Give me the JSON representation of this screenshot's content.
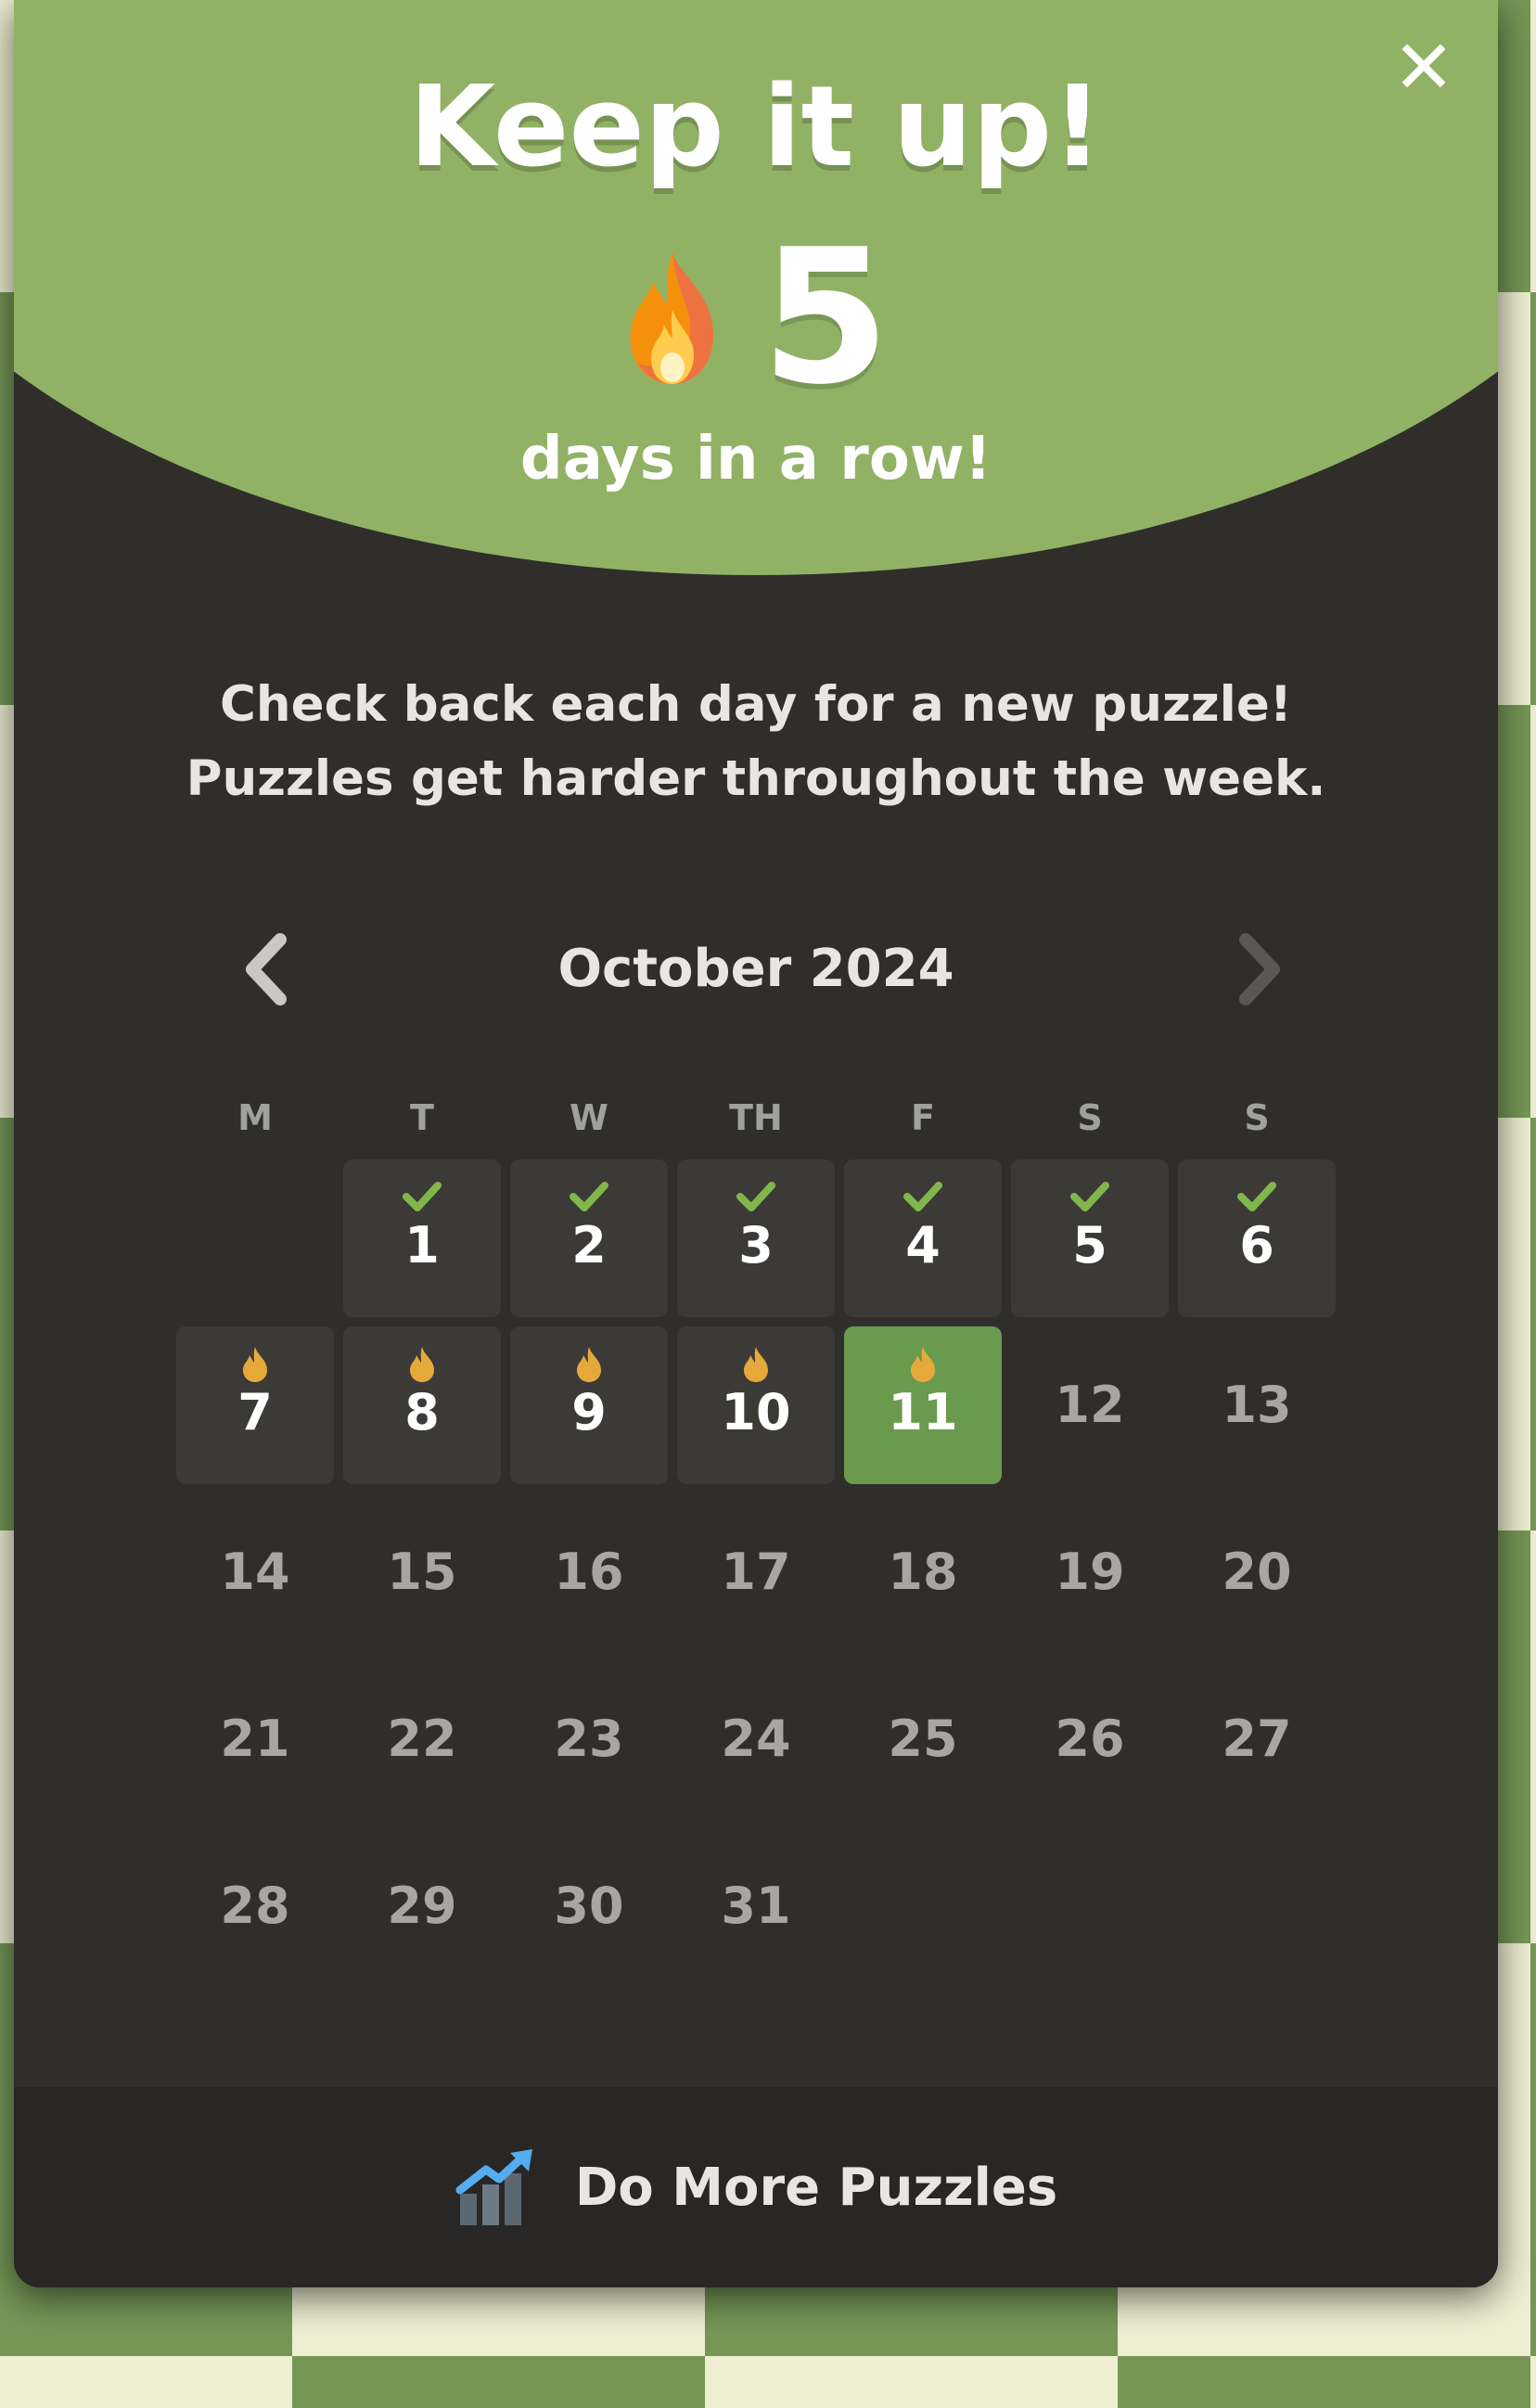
{
  "modal": {
    "title": "Keep it up!",
    "close_label": "✕",
    "streak_count": "5",
    "streak_label": "days in a row!",
    "message_line1": "Check back each day for a new puzzle!",
    "message_line2": "Puzzles get harder throughout the week."
  },
  "calendar": {
    "month_label": "October 2024",
    "weekdays": [
      "M",
      "T",
      "W",
      "TH",
      "F",
      "S",
      "S"
    ],
    "days": [
      {
        "num": "1",
        "status": "completed"
      },
      {
        "num": "2",
        "status": "completed"
      },
      {
        "num": "3",
        "status": "completed"
      },
      {
        "num": "4",
        "status": "completed"
      },
      {
        "num": "5",
        "status": "completed"
      },
      {
        "num": "6",
        "status": "completed"
      },
      {
        "num": "7",
        "status": "streak"
      },
      {
        "num": "8",
        "status": "streak"
      },
      {
        "num": "9",
        "status": "streak"
      },
      {
        "num": "10",
        "status": "streak"
      },
      {
        "num": "11",
        "status": "current"
      },
      {
        "num": "12",
        "status": "none"
      },
      {
        "num": "13",
        "status": "none"
      },
      {
        "num": "14",
        "status": "none"
      },
      {
        "num": "15",
        "status": "none"
      },
      {
        "num": "16",
        "status": "none"
      },
      {
        "num": "17",
        "status": "none"
      },
      {
        "num": "18",
        "status": "none"
      },
      {
        "num": "19",
        "status": "none"
      },
      {
        "num": "20",
        "status": "none"
      },
      {
        "num": "21",
        "status": "none"
      },
      {
        "num": "22",
        "status": "none"
      },
      {
        "num": "23",
        "status": "none"
      },
      {
        "num": "24",
        "status": "none"
      },
      {
        "num": "25",
        "status": "none"
      },
      {
        "num": "26",
        "status": "none"
      },
      {
        "num": "27",
        "status": "none"
      },
      {
        "num": "28",
        "status": "none"
      },
      {
        "num": "29",
        "status": "none"
      },
      {
        "num": "30",
        "status": "none"
      },
      {
        "num": "31",
        "status": "none"
      }
    ]
  },
  "footer": {
    "label": "Do More Puzzles",
    "icon": "chart-up-icon"
  },
  "colors": {
    "header_green": "#91b265",
    "modal_bg": "#302e2b",
    "check_green": "#81b64c",
    "flame_gold": "#e5a93a",
    "current_day": "#6a9a4e"
  }
}
